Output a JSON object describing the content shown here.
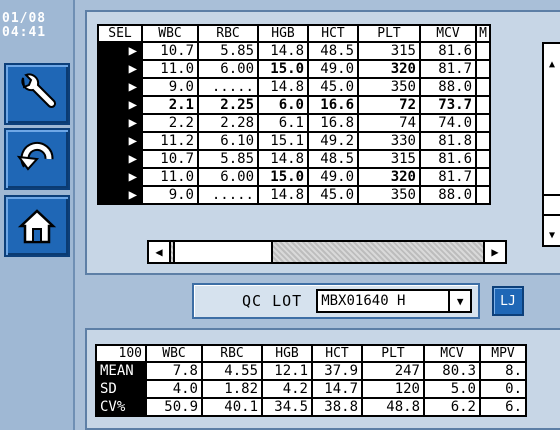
{
  "clock": {
    "date": "01/08",
    "time": "04:41"
  },
  "sidebar": {
    "buttons": [
      {
        "id": "wrench",
        "icon": "wrench-icon"
      },
      {
        "id": "undo",
        "icon": "undo-arrow-icon"
      },
      {
        "id": "home",
        "icon": "home-icon"
      }
    ]
  },
  "grid": {
    "headers": [
      "SEL",
      "WBC",
      "RBC",
      "HGB",
      "HCT",
      "PLT",
      "MCV",
      "M"
    ],
    "rows": [
      {
        "sel": "▶",
        "cells": [
          "10.7",
          "5.85",
          "14.8",
          "48.5",
          "315",
          "81.6"
        ],
        "bold": [
          false,
          false,
          false,
          false,
          false,
          false
        ]
      },
      {
        "sel": "▶",
        "cells": [
          "11.0",
          "6.00",
          "15.0",
          "49.0",
          "320",
          "81.7"
        ],
        "bold": [
          false,
          false,
          true,
          false,
          true,
          false
        ]
      },
      {
        "sel": "▶",
        "cells": [
          "9.0",
          ".....",
          "14.8",
          "45.0",
          "350",
          "88.0"
        ],
        "bold": [
          false,
          false,
          false,
          false,
          false,
          false
        ]
      },
      {
        "sel": "▶",
        "cells": [
          "2.1",
          "2.25",
          "6.0",
          "16.6",
          "72",
          "73.7"
        ],
        "bold": [
          true,
          true,
          true,
          true,
          true,
          true
        ]
      },
      {
        "sel": "▶",
        "cells": [
          "2.2",
          "2.28",
          "6.1",
          "16.8",
          "74",
          "74.0"
        ],
        "bold": [
          false,
          false,
          false,
          false,
          false,
          false
        ]
      },
      {
        "sel": "▶",
        "cells": [
          "11.2",
          "6.10",
          "15.1",
          "49.2",
          "330",
          "81.8"
        ],
        "bold": [
          false,
          false,
          false,
          false,
          false,
          false
        ]
      },
      {
        "sel": "▶",
        "cells": [
          "10.7",
          "5.85",
          "14.8",
          "48.5",
          "315",
          "81.6"
        ],
        "bold": [
          false,
          false,
          false,
          false,
          false,
          false
        ]
      },
      {
        "sel": "▶",
        "cells": [
          "11.0",
          "6.00",
          "15.0",
          "49.0",
          "320",
          "81.7"
        ],
        "bold": [
          false,
          false,
          true,
          false,
          true,
          false
        ]
      },
      {
        "sel": "▶",
        "cells": [
          "9.0",
          ".....",
          "14.8",
          "45.0",
          "350",
          "88.0"
        ],
        "bold": [
          false,
          false,
          false,
          false,
          false,
          false
        ]
      }
    ]
  },
  "scroll": {
    "up": "▲",
    "down": "▼",
    "left": "◀",
    "right": "▶"
  },
  "qc": {
    "label": "QC LOT",
    "lot_value": "MBX01640 H",
    "dropdown_arrow": "▼",
    "lj_label": "LJ"
  },
  "stats": {
    "count": "100",
    "headers": [
      "WBC",
      "RBC",
      "HGB",
      "HCT",
      "PLT",
      "MCV",
      "MPV"
    ],
    "rows": [
      {
        "label": "MEAN",
        "values": [
          "7.8",
          "4.55",
          "12.1",
          "37.9",
          "247",
          "80.3",
          "8."
        ]
      },
      {
        "label": "SD",
        "values": [
          "4.0",
          "1.82",
          "4.2",
          "14.7",
          "120",
          "5.0",
          "0."
        ]
      },
      {
        "label": "CV%",
        "values": [
          "50.9",
          "40.1",
          "34.5",
          "38.8",
          "48.8",
          "6.2",
          "6."
        ]
      }
    ]
  },
  "colors": {
    "button_blue": "#1f67b6",
    "panel_bg": "#c7d6e6",
    "screen_bg": "#a9bfd8"
  }
}
